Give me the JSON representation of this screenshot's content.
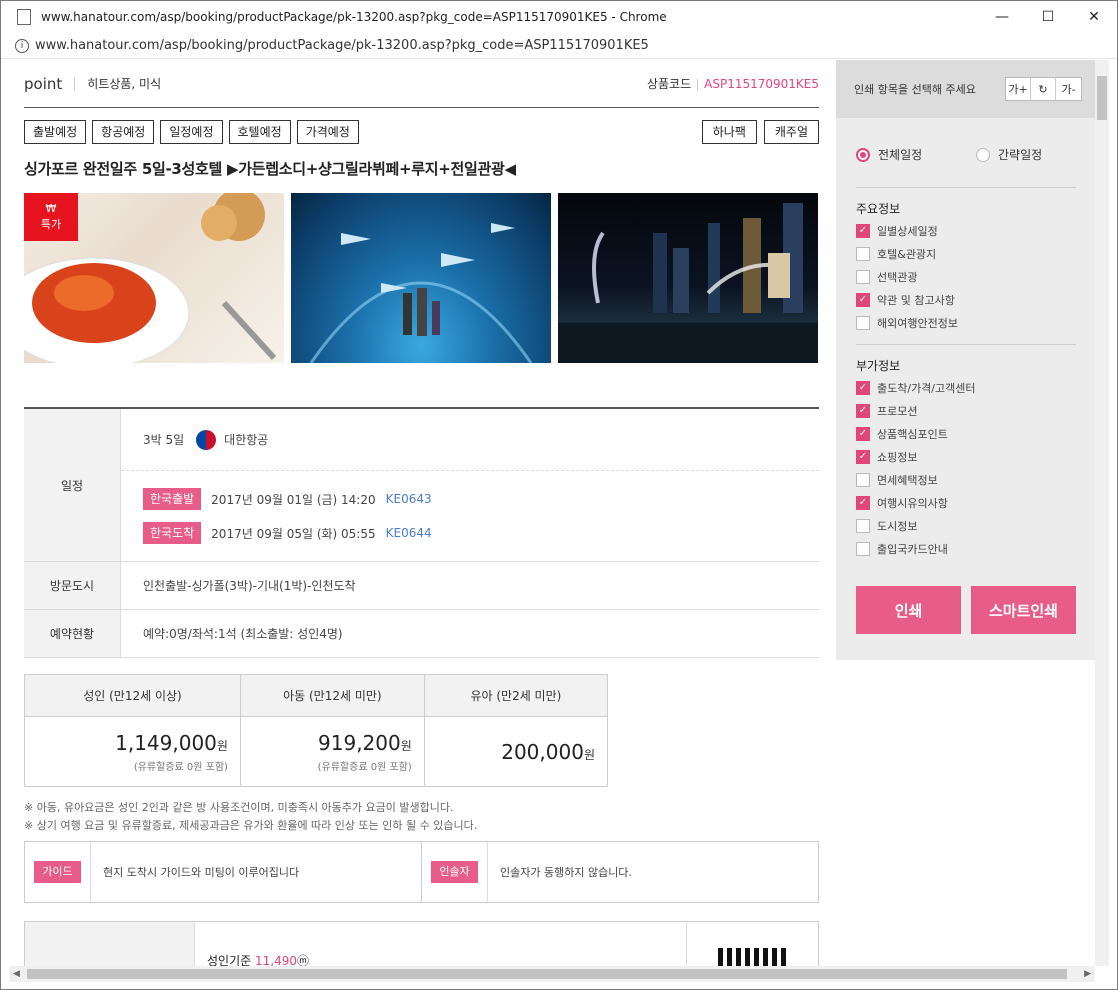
{
  "window": {
    "title": "www.hanatour.com/asp/booking/productPackage/pk-13200.asp?pkg_code=ASP115170901KE5 - Chrome",
    "url": "www.hanatour.com/asp/booking/productPackage/pk-13200.asp?pkg_code=ASP115170901KE5"
  },
  "header": {
    "brand": "point",
    "category": "히트상품, 미식",
    "code_label": "상품코드",
    "code_value": "ASP115170901KE5"
  },
  "buttons": {
    "left": [
      "출발예정",
      "항공예정",
      "일정예정",
      "호텔예정",
      "가격예정"
    ],
    "right": [
      "하나팩",
      "캐주얼"
    ]
  },
  "product_title": "싱가포르 완전일주 5일-3성호텔 ▶가든렙소디+샹그릴라뷔페+루지+전일관광◀",
  "images": {
    "badge_symbol": "₩",
    "badge_label": "특가"
  },
  "schedule": {
    "label": "일정",
    "duration": "3박 5일",
    "airline": "대한항공",
    "depart_tag": "한국출발",
    "depart_time": "2017년 09월 01일 (금) 14:20",
    "depart_flight": "KE0643",
    "arrive_tag": "한국도착",
    "arrive_time": "2017년 09월 05일 (화) 05:55",
    "arrive_flight": "KE0644"
  },
  "cities": {
    "label": "방문도시",
    "value": "인천출발-싱가폴(3박)-기내(1박)-인천도착"
  },
  "reservation": {
    "label": "예약현황",
    "value": "예약:0명/좌석:1석 (최소출발: 성인4명)"
  },
  "prices": {
    "headers": [
      "성인 (만12세 이상)",
      "아동 (만12세 미만)",
      "유아 (만2세 미만)"
    ],
    "amounts": [
      "1,149,000",
      "919,200",
      "200,000"
    ],
    "unit": "원",
    "subs": [
      "(유류할증료 0원 포함)",
      "(유류할증료 0원 포함)"
    ]
  },
  "notes": [
    "※ 아동, 유아요금은 성인 2인과 같은 방 사용조건이며, 미충족시 아동추가 요금이 발생합니다.",
    "※ 상기 여행 요금 및 유류할증료, 제세공과금은 유가와 환율에 따라 인상 또는 인하 될 수 있습니다."
  ],
  "guide": {
    "guide_tag": "가이드",
    "guide_text": "현지 도착시 가이드와 미팅이 이루어집니다",
    "escort_tag": "인솔자",
    "escort_text": "인솔자가 동행하지 않습니다."
  },
  "bottom": {
    "label": "성인기준",
    "value": "11,490",
    "suffix": "ⓜ"
  },
  "print_panel": {
    "title": "인쇄 항목을 선택해 주세요",
    "tools": [
      "가+",
      "↻",
      "가-"
    ],
    "radio_full": "전체일정",
    "radio_brief": "간략일정",
    "group1_title": "주요정보",
    "group1": [
      {
        "label": "일별상세일정",
        "checked": true
      },
      {
        "label": "호텔&관광지",
        "checked": false
      },
      {
        "label": "선택관광",
        "checked": false
      },
      {
        "label": "약관 및 참고사항",
        "checked": true
      },
      {
        "label": "해외여행안전정보",
        "checked": false
      }
    ],
    "group2_title": "부가정보",
    "group2": [
      {
        "label": "출도착/가격/고객센터",
        "checked": true
      },
      {
        "label": "프로모션",
        "checked": true
      },
      {
        "label": "상품핵심포인트",
        "checked": true
      },
      {
        "label": "쇼핑정보",
        "checked": true
      },
      {
        "label": "면세혜택정보",
        "checked": false
      },
      {
        "label": "여행시유의사항",
        "checked": true
      },
      {
        "label": "도시정보",
        "checked": false
      },
      {
        "label": "출입국카드안내",
        "checked": false
      }
    ],
    "print_btn": "인쇄",
    "smart_btn": "스마트인쇄"
  },
  "colors": {
    "accent": "#e0457b",
    "pill": "#e85c8a",
    "badge": "#e6141e",
    "link": "#4a7ec9"
  }
}
